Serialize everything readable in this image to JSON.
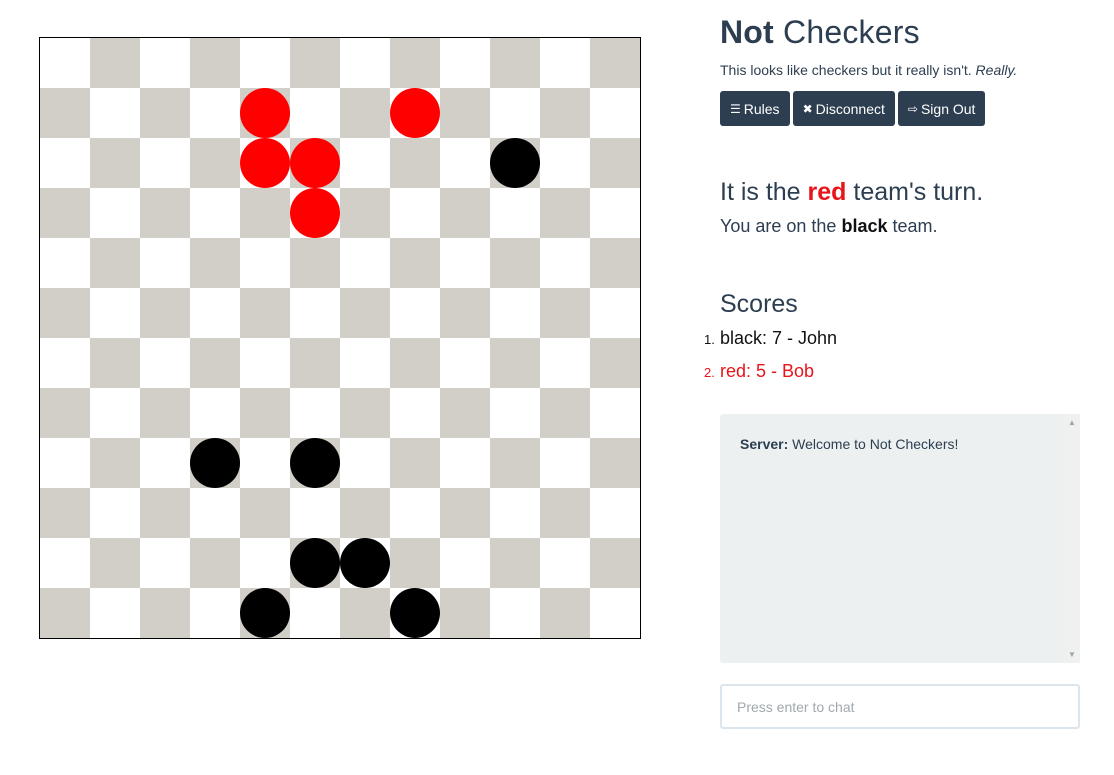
{
  "app": {
    "title_bold": "Not",
    "title_rest": " Checkers",
    "tagline": "This looks like checkers but it really isn't. ",
    "tagline_emph": "Really."
  },
  "toolbar": {
    "rules": {
      "label": "Rules",
      "icon": "list-icon"
    },
    "disconnect": {
      "label": "Disconnect",
      "icon": "close-icon"
    },
    "signout": {
      "label": "Sign Out",
      "icon": "sign-out-icon"
    }
  },
  "status": {
    "turn_prefix": "It is the ",
    "turn_team": "red",
    "turn_suffix": " team's turn.",
    "you_prefix": "You are on the ",
    "you_team": "black",
    "you_suffix": " team."
  },
  "scores": {
    "title": "Scores",
    "entries": [
      {
        "num": "1.",
        "text": "black: 7 - John"
      },
      {
        "num": "2.",
        "text": "red: 5 - Bob"
      }
    ]
  },
  "chat": {
    "messages": [
      {
        "sender": "Server:",
        "text": " Welcome to Not Checkers!"
      }
    ],
    "placeholder": "Press enter to chat"
  },
  "colors": {
    "dark_square": "#d2cfc9",
    "light_square": "#ffffff",
    "red_piece": "#ff0000",
    "black_piece": "#000000",
    "button_bg": "#2c3e50"
  },
  "board": {
    "size": 12,
    "pieces": [
      {
        "row": 1,
        "col": 4,
        "team": "red"
      },
      {
        "row": 1,
        "col": 7,
        "team": "red"
      },
      {
        "row": 2,
        "col": 4,
        "team": "red"
      },
      {
        "row": 2,
        "col": 5,
        "team": "red"
      },
      {
        "row": 3,
        "col": 5,
        "team": "red"
      },
      {
        "row": 2,
        "col": 9,
        "team": "black"
      },
      {
        "row": 8,
        "col": 3,
        "team": "black"
      },
      {
        "row": 8,
        "col": 5,
        "team": "black"
      },
      {
        "row": 10,
        "col": 5,
        "team": "black"
      },
      {
        "row": 10,
        "col": 6,
        "team": "black"
      },
      {
        "row": 11,
        "col": 4,
        "team": "black"
      },
      {
        "row": 11,
        "col": 7,
        "team": "black"
      }
    ]
  }
}
